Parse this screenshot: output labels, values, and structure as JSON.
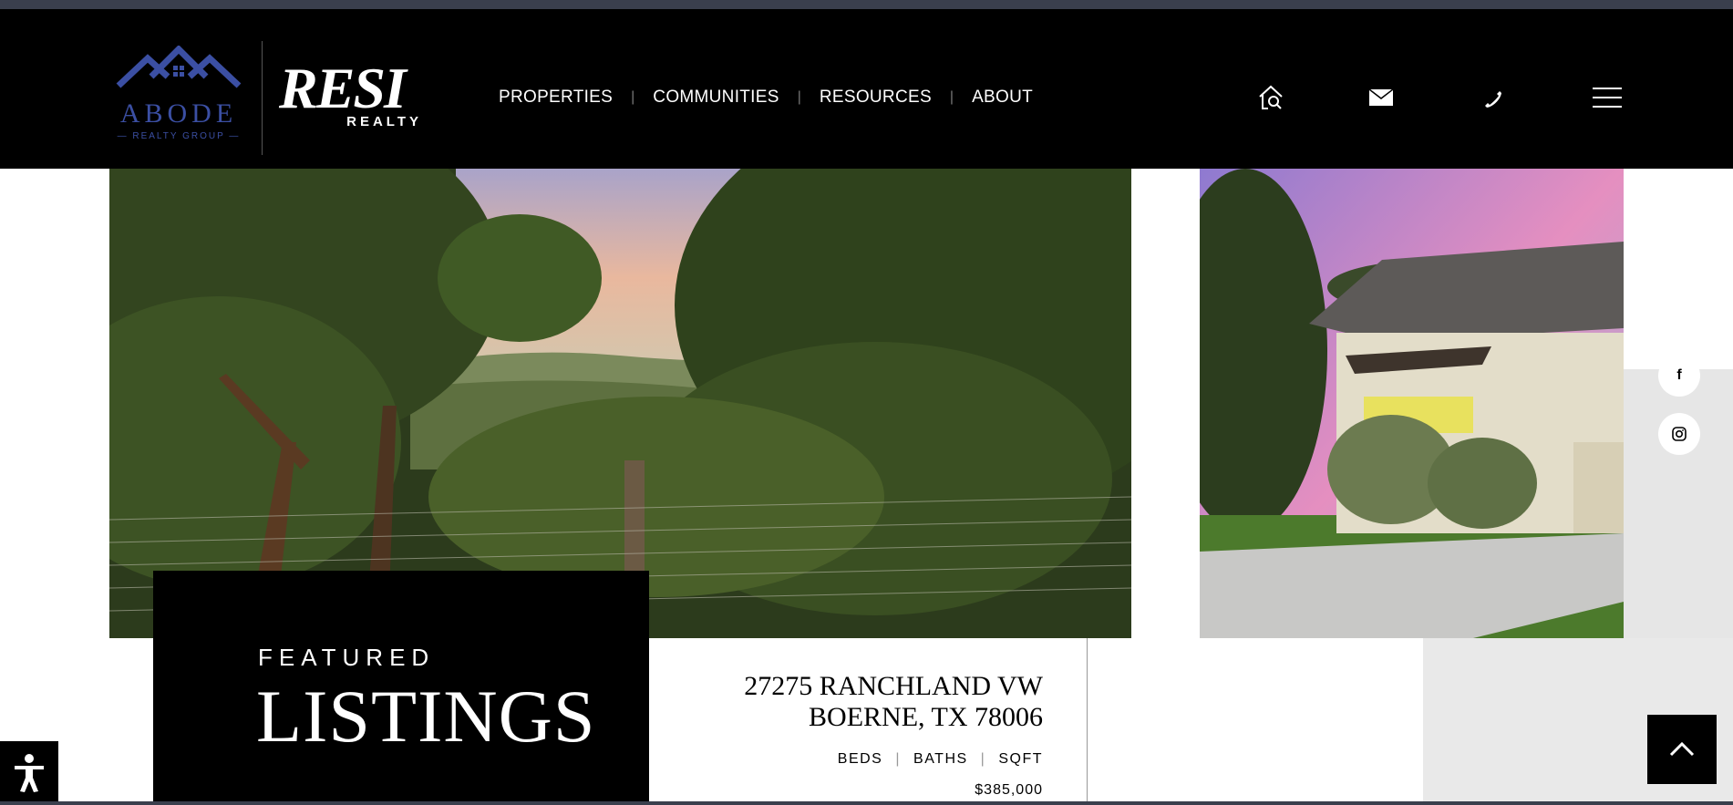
{
  "brand": {
    "abode_name": "ABODE",
    "abode_sub": "— REALTY GROUP —",
    "resi_name": "RESI",
    "resi_sub": "REALTY"
  },
  "nav": {
    "items": [
      "PROPERTIES",
      "COMMUNITIES",
      "RESOURCES",
      "ABOUT"
    ]
  },
  "header_icons": [
    "home-search-icon",
    "mail-icon",
    "phone-icon",
    "menu-icon"
  ],
  "social": [
    {
      "icon": "facebook-icon",
      "glyph": "f"
    },
    {
      "icon": "instagram-icon",
      "glyph": ""
    }
  ],
  "featured": {
    "kicker": "FEATURED",
    "title": "LISTINGS"
  },
  "listing": {
    "address_line1": "27275 RANCHLAND VW",
    "address_line2": "BOERNE, TX 78006",
    "stats": [
      "BEDS",
      "BATHS",
      "SQFT"
    ],
    "price": "$385,000"
  },
  "colors": {
    "brand_blue": "#3b4fa3",
    "header_bg": "#000000"
  }
}
